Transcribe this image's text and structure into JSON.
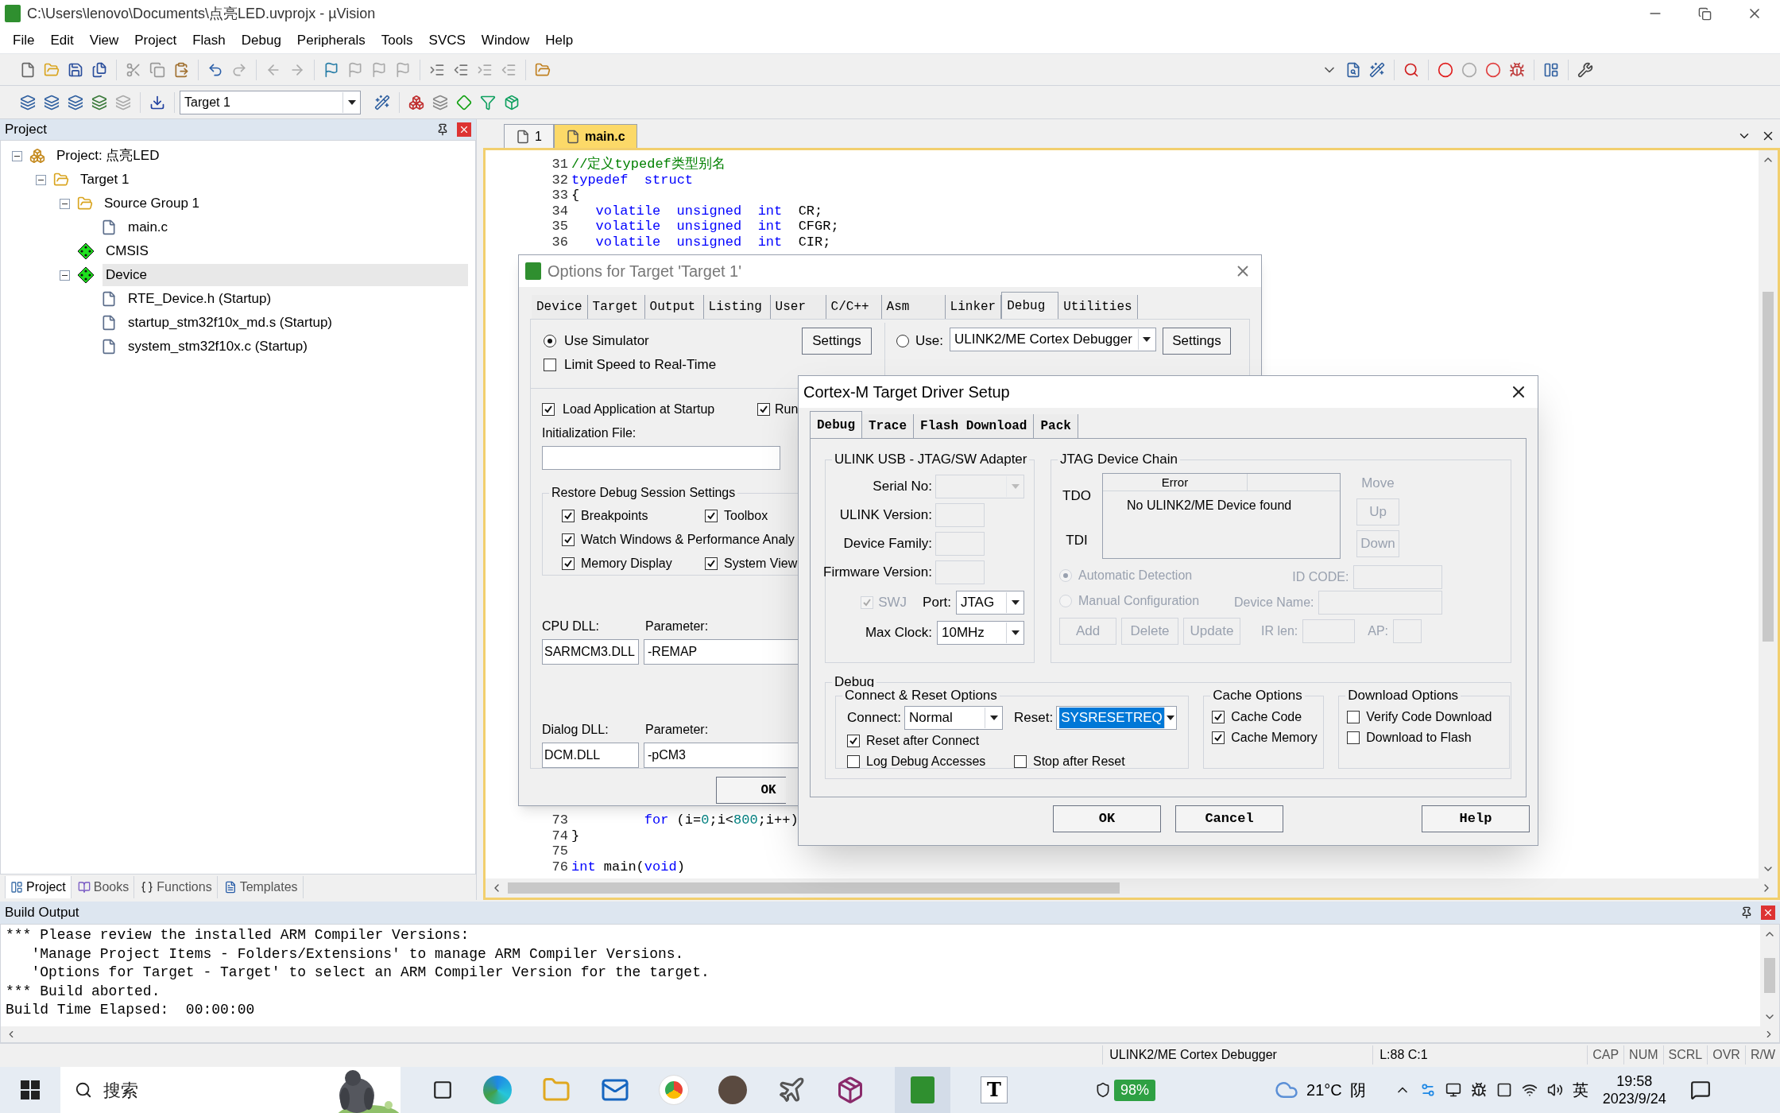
{
  "window": {
    "title": "C:\\Users\\lenovo\\Documents\\点亮LED.uvprojx - µVision"
  },
  "menu": [
    "File",
    "Edit",
    "View",
    "Project",
    "Flash",
    "Debug",
    "Peripherals",
    "Tools",
    "SVCS",
    "Window",
    "Help"
  ],
  "toolbar": {
    "target": "Target 1"
  },
  "project_pane": {
    "title": "Project",
    "tree": [
      {
        "label": "Project: 点亮LED",
        "kind": "project",
        "expanded": true,
        "selected": false,
        "children": [
          {
            "label": "Target 1",
            "kind": "target",
            "expanded": true,
            "selected": false,
            "children": [
              {
                "label": "Source Group 1",
                "kind": "group",
                "expanded": true,
                "selected": false,
                "children": [
                  {
                    "label": "main.c",
                    "kind": "file",
                    "selected": false
                  }
                ]
              },
              {
                "label": "CMSIS",
                "kind": "component",
                "selected": false
              },
              {
                "label": "Device",
                "kind": "component",
                "expanded": true,
                "selected": true,
                "children": [
                  {
                    "label": "RTE_Device.h (Startup)",
                    "kind": "file",
                    "selected": false
                  },
                  {
                    "label": "startup_stm32f10x_md.s (Startup)",
                    "kind": "file",
                    "selected": false
                  },
                  {
                    "label": "system_stm32f10x.c (Startup)",
                    "kind": "file",
                    "selected": false
                  }
                ]
              }
            ]
          }
        ]
      }
    ],
    "tabs": [
      {
        "label": "Project",
        "kind": "project",
        "selected": true
      },
      {
        "label": "Books",
        "kind": "books",
        "selected": false
      },
      {
        "label": "Functions",
        "kind": "functions",
        "selected": false
      },
      {
        "label": "Templates",
        "kind": "templates",
        "selected": false
      }
    ]
  },
  "editor": {
    "tabs": [
      {
        "label": "1",
        "selected": false
      },
      {
        "label": "main.c",
        "selected": true
      }
    ],
    "blocks": [
      [
        {
          "number": "31",
          "tokens": [
            {
              "kind": "comment",
              "text": "//定义typedef类型别名"
            }
          ]
        },
        {
          "number": "32",
          "tokens": [
            {
              "kind": "keyword",
              "text": "typedef"
            },
            {
              "kind": "keyword",
              "text": "  struct"
            }
          ]
        },
        {
          "number": "33",
          "tokens": [
            {
              "kind": "plain",
              "text": "{"
            }
          ]
        },
        {
          "number": "34",
          "tokens": [
            {
              "kind": "keyword",
              "text": "   volatile"
            },
            {
              "kind": "keyword",
              "text": "  unsigned"
            },
            {
              "kind": "keyword",
              "text": "  int"
            },
            {
              "kind": "plain",
              "text": "  CR;"
            }
          ]
        },
        {
          "number": "35",
          "tokens": [
            {
              "kind": "keyword",
              "text": "   volatile"
            },
            {
              "kind": "keyword",
              "text": "  unsigned"
            },
            {
              "kind": "keyword",
              "text": "  int"
            },
            {
              "kind": "plain",
              "text": "  CFGR;"
            }
          ]
        },
        {
          "number": "36",
          "tokens": [
            {
              "kind": "keyword",
              "text": "   volatile"
            },
            {
              "kind": "keyword",
              "text": "  unsigned"
            },
            {
              "kind": "keyword",
              "text": "  int"
            },
            {
              "kind": "plain",
              "text": "  CIR;"
            }
          ]
        }
      ],
      [
        {
          "number": "73",
          "tokens": [
            {
              "kind": "keyword",
              "text": "         for"
            },
            {
              "kind": "plain",
              "text": " (i="
            },
            {
              "kind": "number",
              "text": "0"
            },
            {
              "kind": "plain",
              "text": ";i<"
            },
            {
              "kind": "number",
              "text": "800"
            },
            {
              "kind": "plain",
              "text": ";i++)"
            }
          ]
        },
        {
          "number": "74",
          "tokens": [
            {
              "kind": "plain",
              "text": "}"
            }
          ]
        },
        {
          "number": "75"
        },
        {
          "number": "76",
          "tokens": [
            {
              "kind": "keyword",
              "text": "int"
            },
            {
              "kind": "plain",
              "text": " main("
            },
            {
              "kind": "keyword",
              "text": "void"
            },
            {
              "kind": "plain",
              "text": ")"
            }
          ]
        }
      ]
    ]
  },
  "build_output": {
    "title": "Build Output",
    "lines": [
      "*** Please review the installed ARM Compiler Versions:",
      "   'Manage Project Items - Folders/Extensions' to manage ARM Compiler Versions.",
      "   'Options for Target - Target' to select an ARM Compiler Version for the target.",
      "*** Build aborted.",
      "Build Time Elapsed:  00:00:00"
    ]
  },
  "status_bar": {
    "debugger": "ULINK2/ME Cortex Debugger",
    "position": "L:88 C:1",
    "indicators": [
      "CAP",
      "NUM",
      "SCRL",
      "OVR",
      "R/W"
    ]
  },
  "options_dialog": {
    "title": "Options for Target 'Target 1'",
    "tabs": [
      {
        "label": "Device",
        "selected": false
      },
      {
        "label": "Target",
        "selected": false
      },
      {
        "label": "Output",
        "selected": false
      },
      {
        "label": "Listing",
        "selected": false
      },
      {
        "label": "User",
        "selected": false
      },
      {
        "label": "C/C++",
        "selected": false
      },
      {
        "label": "Asm",
        "selected": false
      },
      {
        "label": "Linker",
        "selected": false
      },
      {
        "label": "Debug",
        "selected": true
      },
      {
        "label": "Utilities",
        "selected": false
      }
    ],
    "use_simulator": {
      "label": "Use Simulator",
      "selected": true
    },
    "settings_left": "Settings",
    "limit_speed": {
      "label": "Limit Speed to Real-Time",
      "checked": false
    },
    "use": {
      "label": "Use:",
      "selected": false
    },
    "debugger": "ULINK2/ME Cortex Debugger",
    "settings_right": "Settings",
    "load_app": {
      "label": "Load Application at Startup",
      "checked": true
    },
    "run": {
      "label": "Run",
      "checked": true
    },
    "init_file_label": "Initialization File:",
    "restore_group": {
      "title": "Restore Debug Session Settings",
      "options": [
        {
          "label": "Breakpoints",
          "checked": true
        },
        {
          "label": "Toolbox",
          "checked": true
        },
        {
          "label": "Watch Windows & Performance Analy",
          "checked": true
        },
        {
          "label": "Memory Display",
          "checked": true
        },
        {
          "label": "System View",
          "checked": true
        }
      ]
    },
    "dlls": [
      {
        "label": "CPU DLL:",
        "value": "SARMCM3.DLL",
        "param_label": "Parameter:",
        "param": "-REMAP"
      },
      {
        "label": "Dialog DLL:",
        "value": "DCM.DLL",
        "param_label": "Parameter:",
        "param": "-pCM3"
      }
    ],
    "ok": "OK"
  },
  "driver_dialog": {
    "title": "Cortex-M Target Driver Setup",
    "tabs": [
      {
        "label": "Debug",
        "selected": true
      },
      {
        "label": "Trace",
        "selected": false
      },
      {
        "label": "Flash Download",
        "selected": false
      },
      {
        "label": "Pack",
        "selected": false
      }
    ],
    "adapter": {
      "title": "ULINK USB - JTAG/SW Adapter",
      "serial_label": "Serial No:",
      "ulink_version_label": "ULINK Version:",
      "device_family_label": "Device Family:",
      "firmware_label": "Firmware Version:",
      "swj": {
        "label": "SWJ",
        "checked": true,
        "disabled": true
      },
      "port_label": "Port:",
      "port": "JTAG",
      "clock_label": "Max Clock:",
      "clock": "10MHz"
    },
    "jtag": {
      "title": "JTAG Device Chain",
      "tdo": "TDO",
      "tdi": "TDI",
      "column_1": "Error",
      "row": "No ULINK2/ME Device found",
      "move": "Move",
      "up": "Up",
      "down": "Down",
      "modes": [
        {
          "label": "Automatic Detection",
          "selected": true
        },
        {
          "label": "Manual Configuration",
          "selected": false
        }
      ],
      "id_code_label": "ID CODE:",
      "device_name_label": "Device Name:",
      "buttons": [
        "Add",
        "Delete",
        "Update"
      ],
      "ir_len_label": "IR len:",
      "ap_label": "AP:"
    },
    "debug": {
      "title": "Debug",
      "connect_reset": {
        "title": "Connect & Reset Options",
        "connect_label": "Connect:",
        "connect": "Normal",
        "reset_label": "Reset:",
        "reset": "SYSRESETREQ",
        "reset_focused": true,
        "options": [
          {
            "label": "Reset after Connect",
            "checked": true
          },
          {
            "label": "Log Debug Accesses",
            "checked": false
          },
          {
            "label": "Stop after Reset",
            "checked": false
          }
        ]
      },
      "cache": {
        "title": "Cache Options",
        "options": [
          {
            "label": "Cache Code",
            "checked": true
          },
          {
            "label": "Cache Memory",
            "checked": true
          }
        ]
      },
      "download": {
        "title": "Download Options",
        "options": [
          {
            "label": "Verify Code Download",
            "checked": false
          },
          {
            "label": "Download to Flash",
            "checked": false
          }
        ]
      }
    },
    "buttons": [
      "OK",
      "Cancel",
      "Help"
    ]
  },
  "taskbar": {
    "search_placeholder": "搜索",
    "app_letter": "T",
    "battery": "98%",
    "temperature": "21°C",
    "weather": "阴",
    "ime": "英",
    "time": "19:58",
    "date": "2023/9/24"
  }
}
